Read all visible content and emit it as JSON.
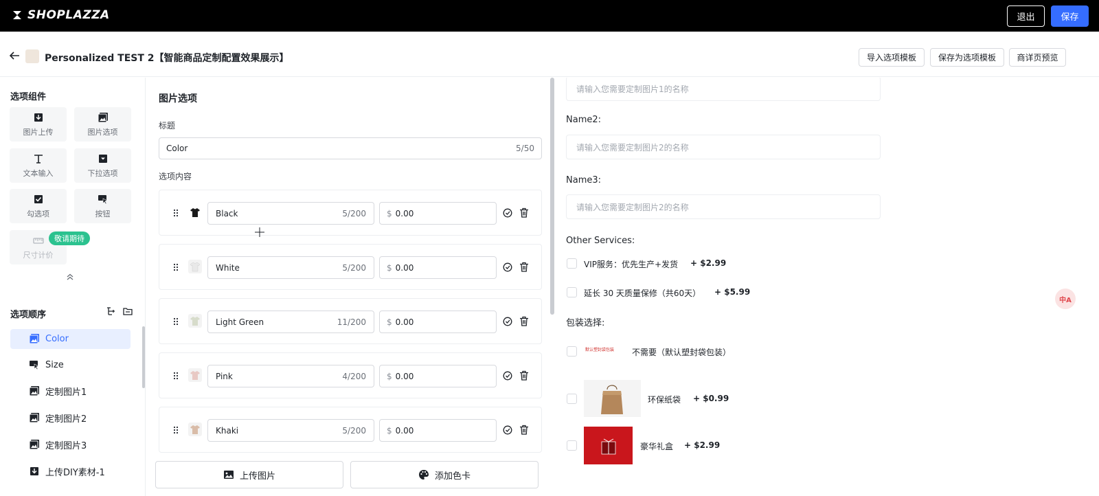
{
  "topbar": {
    "logo_text": "SHOPLAZZA",
    "exit_label": "退出",
    "save_label": "保存",
    "accent": "#356dff"
  },
  "header": {
    "title": "Personalized TEST 2【智能商品定制配置效果展示】",
    "buttons": [
      "导入选项模板",
      "保存为选项模板",
      "商详页预览"
    ]
  },
  "left": {
    "components_title": "选项组件",
    "components": [
      {
        "label": "图片上传",
        "icon": "download-icon"
      },
      {
        "label": "图片选项",
        "icon": "image-icon"
      },
      {
        "label": "文本输入",
        "icon": "text-icon"
      },
      {
        "label": "下拉选项",
        "icon": "dropdown-icon"
      },
      {
        "label": "勾选项",
        "icon": "checkbox-icon"
      },
      {
        "label": "按钮",
        "icon": "button-cursor-icon"
      },
      {
        "label": "尺寸计价",
        "icon": "ruler-icon"
      }
    ],
    "coming_soon_badge": "敬请期待",
    "order_title": "选项顺序",
    "order_items": [
      {
        "label": "Color",
        "icon": "image-icon",
        "active": true
      },
      {
        "label": "Size",
        "icon": "button-cursor-icon",
        "active": false
      },
      {
        "label": "定制图片1",
        "icon": "image-icon",
        "active": false
      },
      {
        "label": "定制图片2",
        "icon": "image-icon",
        "active": false
      },
      {
        "label": "定制图片3",
        "icon": "image-icon",
        "active": false
      },
      {
        "label": "上传DIY素材-1",
        "icon": "download-icon",
        "active": false
      }
    ]
  },
  "middle": {
    "section_title": "图片选项",
    "title_label": "标题",
    "title_value": "Color",
    "title_count": "5/50",
    "content_label": "选项内容",
    "options": [
      {
        "name": "Black",
        "count": "5/200",
        "currency": "$",
        "price": "0.00",
        "swatch": "#1a1a1a"
      },
      {
        "name": "White",
        "count": "5/200",
        "currency": "$",
        "price": "0.00",
        "swatch": "#e9e9e9"
      },
      {
        "name": "Light Green",
        "count": "11/200",
        "currency": "$",
        "price": "0.00",
        "swatch": "#d7dccb"
      },
      {
        "name": "Pink",
        "count": "4/200",
        "currency": "$",
        "price": "0.00",
        "swatch": "#e8c9c4"
      },
      {
        "name": "Khaki",
        "count": "5/200",
        "currency": "$",
        "price": "0.00",
        "swatch": "#d9bca8"
      }
    ],
    "upload_image_label": "上传图片",
    "add_color_label": "添加色卡"
  },
  "right": {
    "name1_placeholder": "请输入您需要定制图片1的名称",
    "name2_label": "Name2:",
    "name2_placeholder": "请输入您需要定制图片2的名称",
    "name3_label": "Name3:",
    "name3_placeholder": "请输入您需要定制图片2的名称",
    "other_services_label": "Other Services:",
    "services": [
      {
        "text": "VIP服务：优先生产+发货",
        "price": "+ $2.99"
      },
      {
        "text": "延长 30 天质量保修（共60天）",
        "price": "+ $5.99"
      }
    ],
    "packaging_label": "包装选择:",
    "packaging": [
      {
        "thumb_text": "默认塑封袋包装",
        "text": "不需要（默认塑封袋包装）",
        "price": ""
      },
      {
        "text": "环保纸袋",
        "price": "+ $0.99"
      },
      {
        "text": "豪华礼盒",
        "price": "+ $2.99"
      }
    ]
  }
}
